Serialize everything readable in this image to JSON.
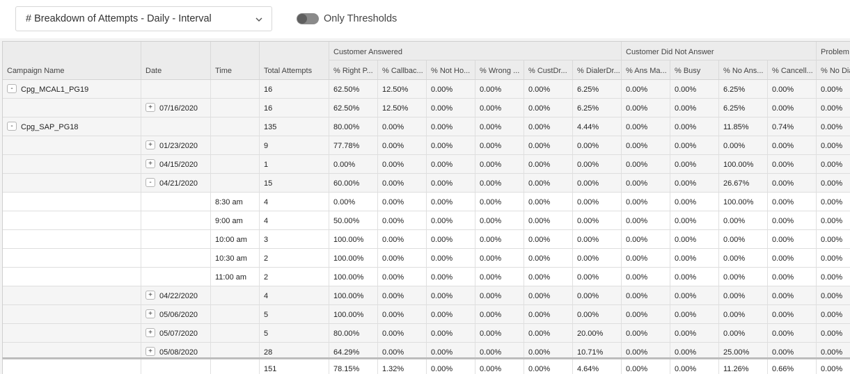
{
  "toolbar": {
    "report_select": {
      "value": "# Breakdown of Attempts - Daily - Interval",
      "icon": "chevron-down-icon"
    },
    "threshold_toggle": {
      "label": "Only Thresholds",
      "on": false
    }
  },
  "table": {
    "column_groups": [
      {
        "label": "Customer Answered"
      },
      {
        "label": "Customer Did Not Answer"
      },
      {
        "label": "Problem"
      }
    ],
    "columns": [
      "Campaign Name",
      "Date",
      "Time",
      "Total Attempts",
      "% Right P...",
      "% Callbac...",
      "% Not Ho...",
      "% Wrong ...",
      "% CustDr...",
      "% DialerDr...",
      "% Ans Ma...",
      "% Busy",
      "% No Ans...",
      "% Cancell...",
      "% No Dia"
    ],
    "rows": [
      {
        "type": "grouped",
        "expander": "-",
        "campaign": "Cpg_MCAL1_PG19",
        "date": "",
        "time": "",
        "total": "16",
        "values": [
          "62.50%",
          "12.50%",
          "0.00%",
          "0.00%",
          "0.00%",
          "6.25%",
          "0.00%",
          "0.00%",
          "6.25%",
          "0.00%",
          "0.00%"
        ]
      },
      {
        "type": "grouped",
        "expander": "+",
        "campaign": "",
        "date": "07/16/2020",
        "time": "",
        "total": "16",
        "values": [
          "62.50%",
          "12.50%",
          "0.00%",
          "0.00%",
          "0.00%",
          "6.25%",
          "0.00%",
          "0.00%",
          "6.25%",
          "0.00%",
          "0.00%"
        ]
      },
      {
        "type": "grouped",
        "expander": "-",
        "campaign": "Cpg_SAP_PG18",
        "date": "",
        "time": "",
        "total": "135",
        "values": [
          "80.00%",
          "0.00%",
          "0.00%",
          "0.00%",
          "0.00%",
          "4.44%",
          "0.00%",
          "0.00%",
          "11.85%",
          "0.74%",
          "0.00%"
        ]
      },
      {
        "type": "grouped",
        "expander": "+",
        "campaign": "",
        "date": "01/23/2020",
        "time": "",
        "total": "9",
        "values": [
          "77.78%",
          "0.00%",
          "0.00%",
          "0.00%",
          "0.00%",
          "0.00%",
          "0.00%",
          "0.00%",
          "0.00%",
          "0.00%",
          "0.00%"
        ]
      },
      {
        "type": "grouped",
        "expander": "+",
        "campaign": "",
        "date": "04/15/2020",
        "time": "",
        "total": "1",
        "values": [
          "0.00%",
          "0.00%",
          "0.00%",
          "0.00%",
          "0.00%",
          "0.00%",
          "0.00%",
          "0.00%",
          "100.00%",
          "0.00%",
          "0.00%"
        ]
      },
      {
        "type": "grouped",
        "expander": "-",
        "campaign": "",
        "date": "04/21/2020",
        "time": "",
        "total": "15",
        "values": [
          "60.00%",
          "0.00%",
          "0.00%",
          "0.00%",
          "0.00%",
          "0.00%",
          "0.00%",
          "0.00%",
          "26.67%",
          "0.00%",
          "0.00%"
        ]
      },
      {
        "type": "leaf",
        "campaign": "",
        "date": "",
        "time": "8:30 am",
        "total": "4",
        "values": [
          "0.00%",
          "0.00%",
          "0.00%",
          "0.00%",
          "0.00%",
          "0.00%",
          "0.00%",
          "0.00%",
          "100.00%",
          "0.00%",
          "0.00%"
        ]
      },
      {
        "type": "leaf",
        "campaign": "",
        "date": "",
        "time": "9:00 am",
        "total": "4",
        "values": [
          "50.00%",
          "0.00%",
          "0.00%",
          "0.00%",
          "0.00%",
          "0.00%",
          "0.00%",
          "0.00%",
          "0.00%",
          "0.00%",
          "0.00%"
        ]
      },
      {
        "type": "leaf",
        "campaign": "",
        "date": "",
        "time": "10:00 am",
        "total": "3",
        "values": [
          "100.00%",
          "0.00%",
          "0.00%",
          "0.00%",
          "0.00%",
          "0.00%",
          "0.00%",
          "0.00%",
          "0.00%",
          "0.00%",
          "0.00%"
        ]
      },
      {
        "type": "leaf",
        "campaign": "",
        "date": "",
        "time": "10:30 am",
        "total": "2",
        "values": [
          "100.00%",
          "0.00%",
          "0.00%",
          "0.00%",
          "0.00%",
          "0.00%",
          "0.00%",
          "0.00%",
          "0.00%",
          "0.00%",
          "0.00%"
        ]
      },
      {
        "type": "leaf",
        "campaign": "",
        "date": "",
        "time": "11:00 am",
        "total": "2",
        "values": [
          "100.00%",
          "0.00%",
          "0.00%",
          "0.00%",
          "0.00%",
          "0.00%",
          "0.00%",
          "0.00%",
          "0.00%",
          "0.00%",
          "0.00%"
        ]
      },
      {
        "type": "grouped",
        "expander": "+",
        "campaign": "",
        "date": "04/22/2020",
        "time": "",
        "total": "4",
        "values": [
          "100.00%",
          "0.00%",
          "0.00%",
          "0.00%",
          "0.00%",
          "0.00%",
          "0.00%",
          "0.00%",
          "0.00%",
          "0.00%",
          "0.00%"
        ]
      },
      {
        "type": "grouped",
        "expander": "+",
        "campaign": "",
        "date": "05/06/2020",
        "time": "",
        "total": "5",
        "values": [
          "100.00%",
          "0.00%",
          "0.00%",
          "0.00%",
          "0.00%",
          "0.00%",
          "0.00%",
          "0.00%",
          "0.00%",
          "0.00%",
          "0.00%"
        ]
      },
      {
        "type": "grouped",
        "expander": "+",
        "campaign": "",
        "date": "05/07/2020",
        "time": "",
        "total": "5",
        "values": [
          "80.00%",
          "0.00%",
          "0.00%",
          "0.00%",
          "0.00%",
          "20.00%",
          "0.00%",
          "0.00%",
          "0.00%",
          "0.00%",
          "0.00%"
        ]
      },
      {
        "type": "grouped",
        "expander": "+",
        "campaign": "",
        "date": "05/08/2020",
        "time": "",
        "total": "28",
        "values": [
          "64.29%",
          "0.00%",
          "0.00%",
          "0.00%",
          "0.00%",
          "10.71%",
          "0.00%",
          "0.00%",
          "25.00%",
          "0.00%",
          "0.00%"
        ]
      }
    ],
    "footer": {
      "total": "151",
      "values": [
        "78.15%",
        "1.32%",
        "0.00%",
        "0.00%",
        "0.00%",
        "4.64%",
        "0.00%",
        "0.00%",
        "11.26%",
        "0.66%",
        "0.00%"
      ]
    }
  }
}
